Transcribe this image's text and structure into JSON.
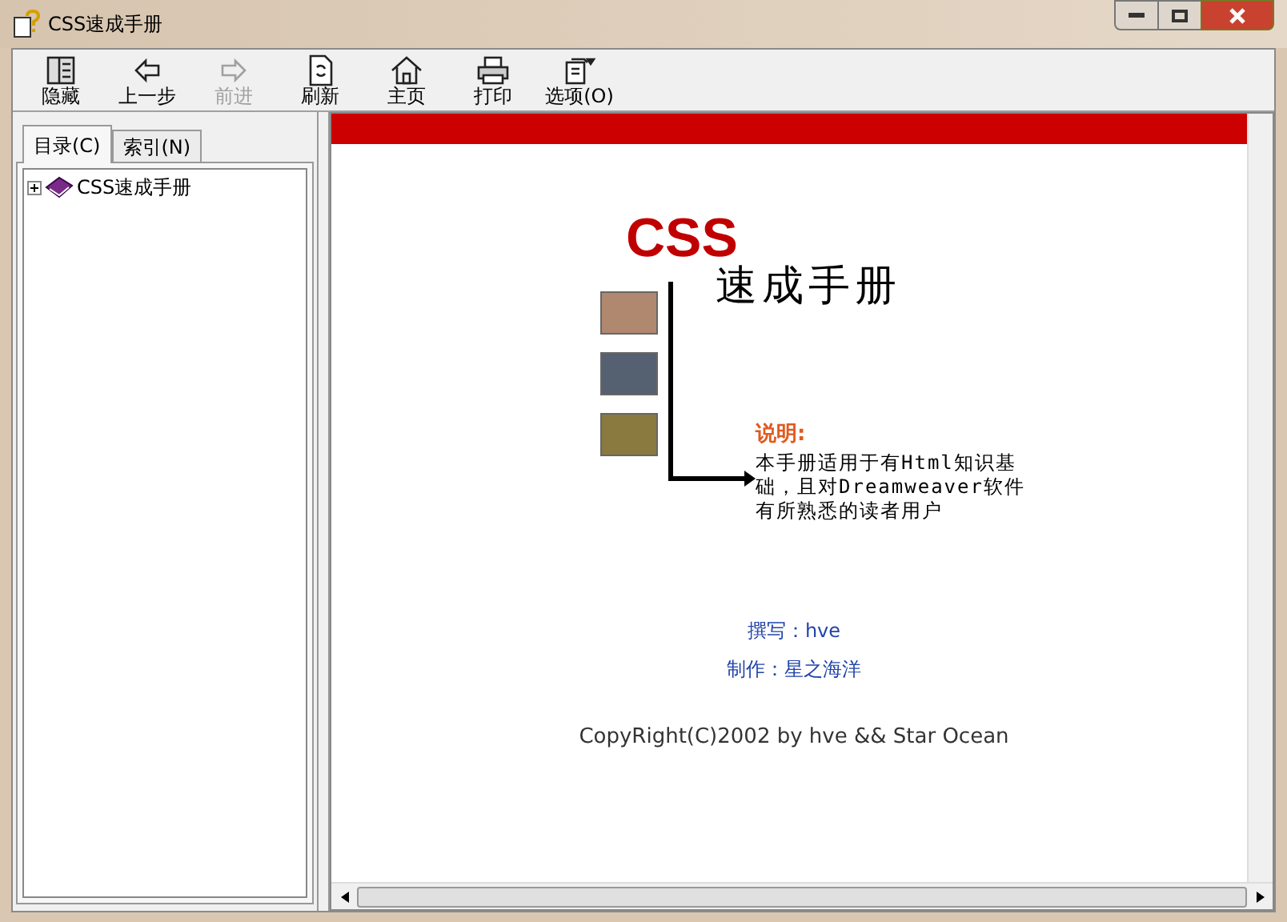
{
  "window": {
    "title": "CSS速成手册"
  },
  "toolbar": [
    {
      "label": "隐藏",
      "kind": "hide",
      "disabled": false
    },
    {
      "label": "上一步",
      "kind": "back",
      "disabled": false
    },
    {
      "label": "前进",
      "kind": "forward",
      "disabled": true
    },
    {
      "label": "刷新",
      "kind": "refresh",
      "disabled": false
    },
    {
      "label": "主页",
      "kind": "home",
      "disabled": false
    },
    {
      "label": "打印",
      "kind": "print",
      "disabled": false
    },
    {
      "label": "选项(O)",
      "kind": "options",
      "disabled": false
    }
  ],
  "tabs": [
    {
      "label": "目录(C)",
      "selected": true
    },
    {
      "label": "索引(N)",
      "selected": false
    }
  ],
  "tree": [
    {
      "label": "CSS速成手册",
      "expanded": false
    }
  ],
  "page": {
    "logo": "CSS",
    "title": "速成手册",
    "note_heading": "说明:",
    "note": "本手册适用于有Html知识基础，且对Dreamweaver软件有所熟悉的读者用户",
    "author": "撰写：hve",
    "maker": "制作：星之海洋",
    "copyright": "CopyRight(C)2002 by hve && Star Ocean"
  }
}
